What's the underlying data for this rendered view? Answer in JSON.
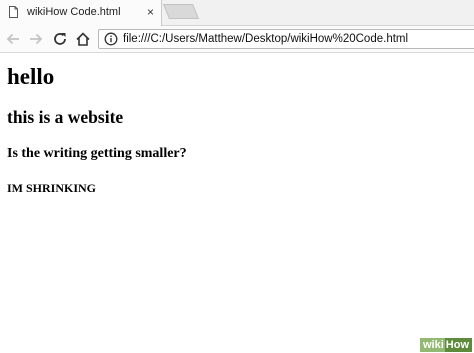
{
  "browser": {
    "tab": {
      "title": "wikiHow Code.html",
      "close_label": "×",
      "icon": "document-icon"
    },
    "toolbar": {
      "back_icon": "back-arrow-icon",
      "forward_icon": "forward-arrow-icon",
      "reload_icon": "reload-icon",
      "home_icon": "home-icon",
      "info_icon": "info-icon",
      "url": "file:///C:/Users/Matthew/Desktop/wikiHow%20Code.html"
    }
  },
  "page": {
    "heading1": "hello",
    "heading2": "this is a website",
    "heading3": "Is the writing getting smaller?",
    "heading4": "IM SHRINKING"
  },
  "watermark": {
    "part1": "wiki",
    "part2": "How"
  }
}
